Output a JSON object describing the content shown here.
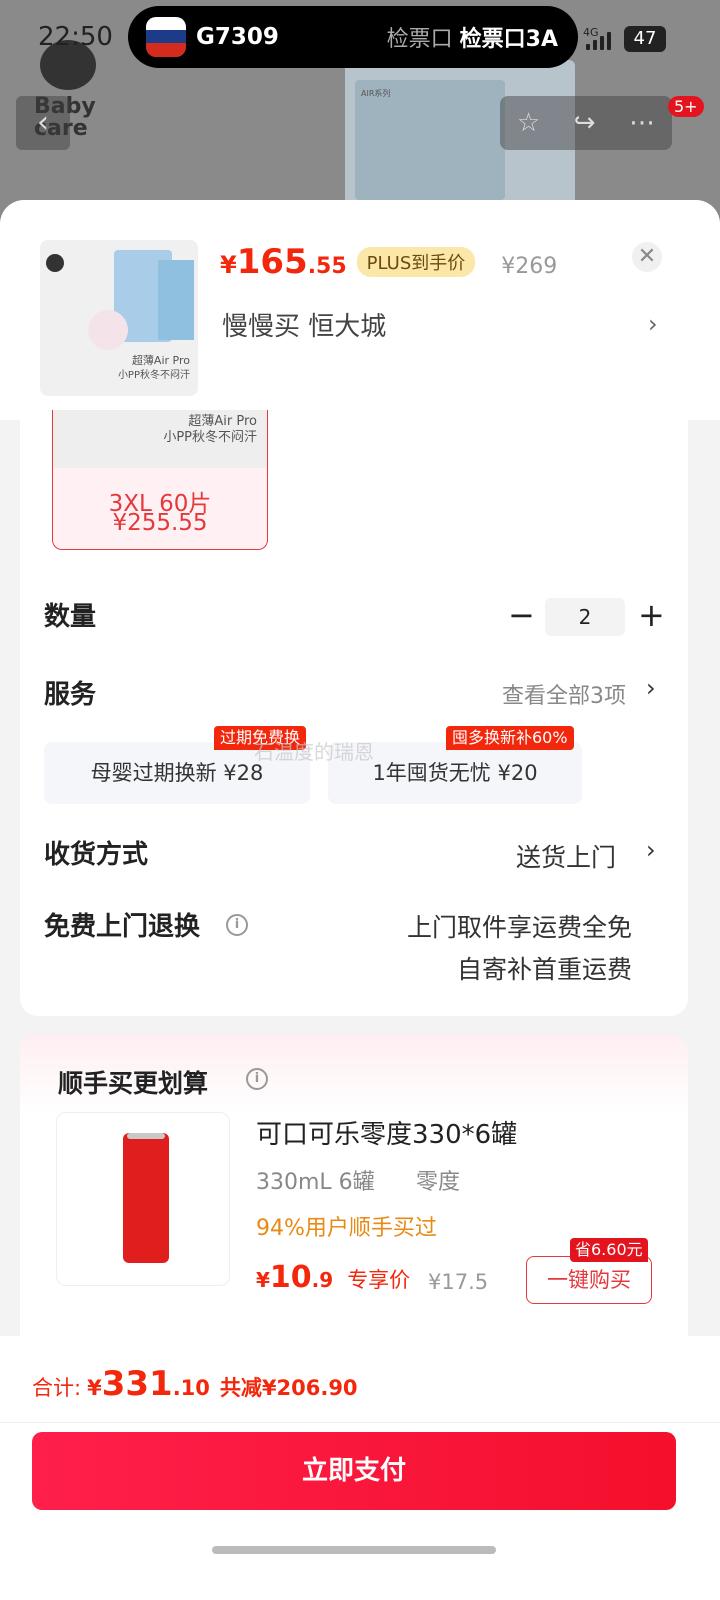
{
  "status_bar": {
    "time": "22:50",
    "live_activity": {
      "train": "G7309",
      "gate_label": "检票口",
      "gate_value": "检票口3A"
    },
    "network": "4G",
    "battery": "47"
  },
  "background_page": {
    "logo_text": "Baby care",
    "notification_badge": "5+",
    "product_caption": "AIR系列"
  },
  "sheet": {
    "header": {
      "thumb_caption_1": "超薄Air Pro",
      "thumb_caption_2": "小PP秋冬不闷汗",
      "price_currency": "¥",
      "price_int": "165",
      "price_dec": ".55",
      "plus_tag": "PLUS到手价",
      "original_price": "¥269",
      "store": "慢慢买  恒大城"
    },
    "sku_selected": {
      "img_caption_1": "超薄Air Pro",
      "img_caption_2": "小PP秋冬不闷汗",
      "name": "3XL 60片",
      "price": "¥255.55"
    },
    "quantity": {
      "label": "数量",
      "value": "2"
    },
    "service": {
      "label": "服务",
      "view_all": "查看全部3项",
      "options": [
        {
          "name": "母婴过期换新  ¥28",
          "tag": "过期免费换"
        },
        {
          "name": "1年囤货无忧  ¥20",
          "tag": "囤多换新补60%"
        }
      ],
      "watermark": "石温度的瑞恩"
    },
    "delivery": {
      "label": "收货方式",
      "value": "送货上门"
    },
    "free_return": {
      "label": "免费上门退换",
      "line1": "上门取件享运费全免",
      "line2": "自寄补首重运费"
    },
    "recommend": {
      "title": "顺手买更划算",
      "product": {
        "name": "可口可乐零度330*6罐",
        "spec": "330mL 6罐",
        "flavor": "零度",
        "social_proof": "94%用户顺手买过",
        "price_currency": "¥",
        "price_int": "10",
        "price_dec": ".9",
        "price_label": "专享价",
        "original_price": "¥17.5",
        "save_tag": "省6.60元",
        "buy_label": "一键购买"
      }
    }
  },
  "footer": {
    "total_label": "合计:",
    "total_currency": "¥",
    "total_int": "331",
    "total_dec": ".10",
    "savings": "共减¥206.90",
    "pay_label": "立即支付"
  },
  "colors": {
    "accent": "#f2270c",
    "plus_tag_bg": "#fbe7a8",
    "pay_button": "#ff1f4b"
  }
}
